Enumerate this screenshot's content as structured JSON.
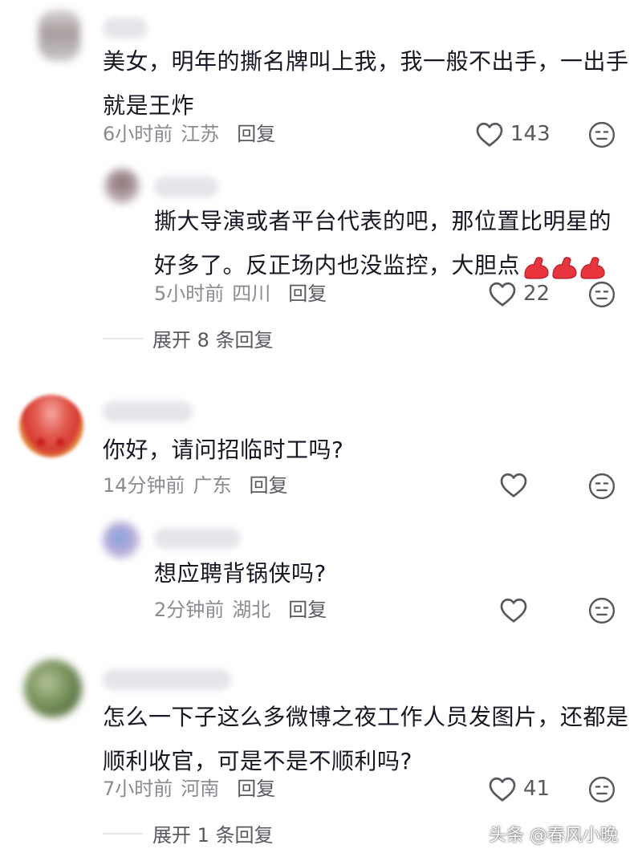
{
  "comments": [
    {
      "text_lines": [
        "美女，明年的撕名牌叫上我，我一般不出手，一出手",
        "就是王炸"
      ],
      "time": "6小时前",
      "location": "江苏",
      "reply_label": "回复",
      "likes": "143",
      "replies": [
        {
          "text_lines": [
            "撕大导演或者平台代表的吧，那位置比明星的",
            "好多了。反正场内也没监控，大胆点"
          ],
          "emoji": "flexed-biceps x3",
          "time": "5小时前",
          "location": "四川",
          "reply_label": "回复",
          "likes": "22"
        }
      ],
      "expand_label": "展开 8 条回复"
    },
    {
      "text_lines": [
        "你好，请问招临时工吗?"
      ],
      "time": "14分钟前",
      "location": "广东",
      "reply_label": "回复",
      "likes": "",
      "replies": [
        {
          "text_lines": [
            "想应聘背锅侠吗?"
          ],
          "time": "2分钟前",
          "location": "湖北",
          "reply_label": "回复",
          "likes": ""
        }
      ]
    },
    {
      "text_lines": [
        "怎么一下子这么多微博之夜工作人员发图片，还都是",
        "顺利收官，可是不是不顺利吗?"
      ],
      "time": "7小时前",
      "location": "河南",
      "reply_label": "回复",
      "likes": "41",
      "expand_label": "展开 1 条回复"
    }
  ],
  "watermark": "头条 @春风小晚",
  "icons": {
    "like": "heart-outline-icon",
    "dislike": "meh-face-icon",
    "reaction": "flexed-biceps-emoji"
  },
  "colors": {
    "text": "#161823",
    "meta": "#8a8b91",
    "reply": "#58595f",
    "emoji": "#e8343c"
  }
}
